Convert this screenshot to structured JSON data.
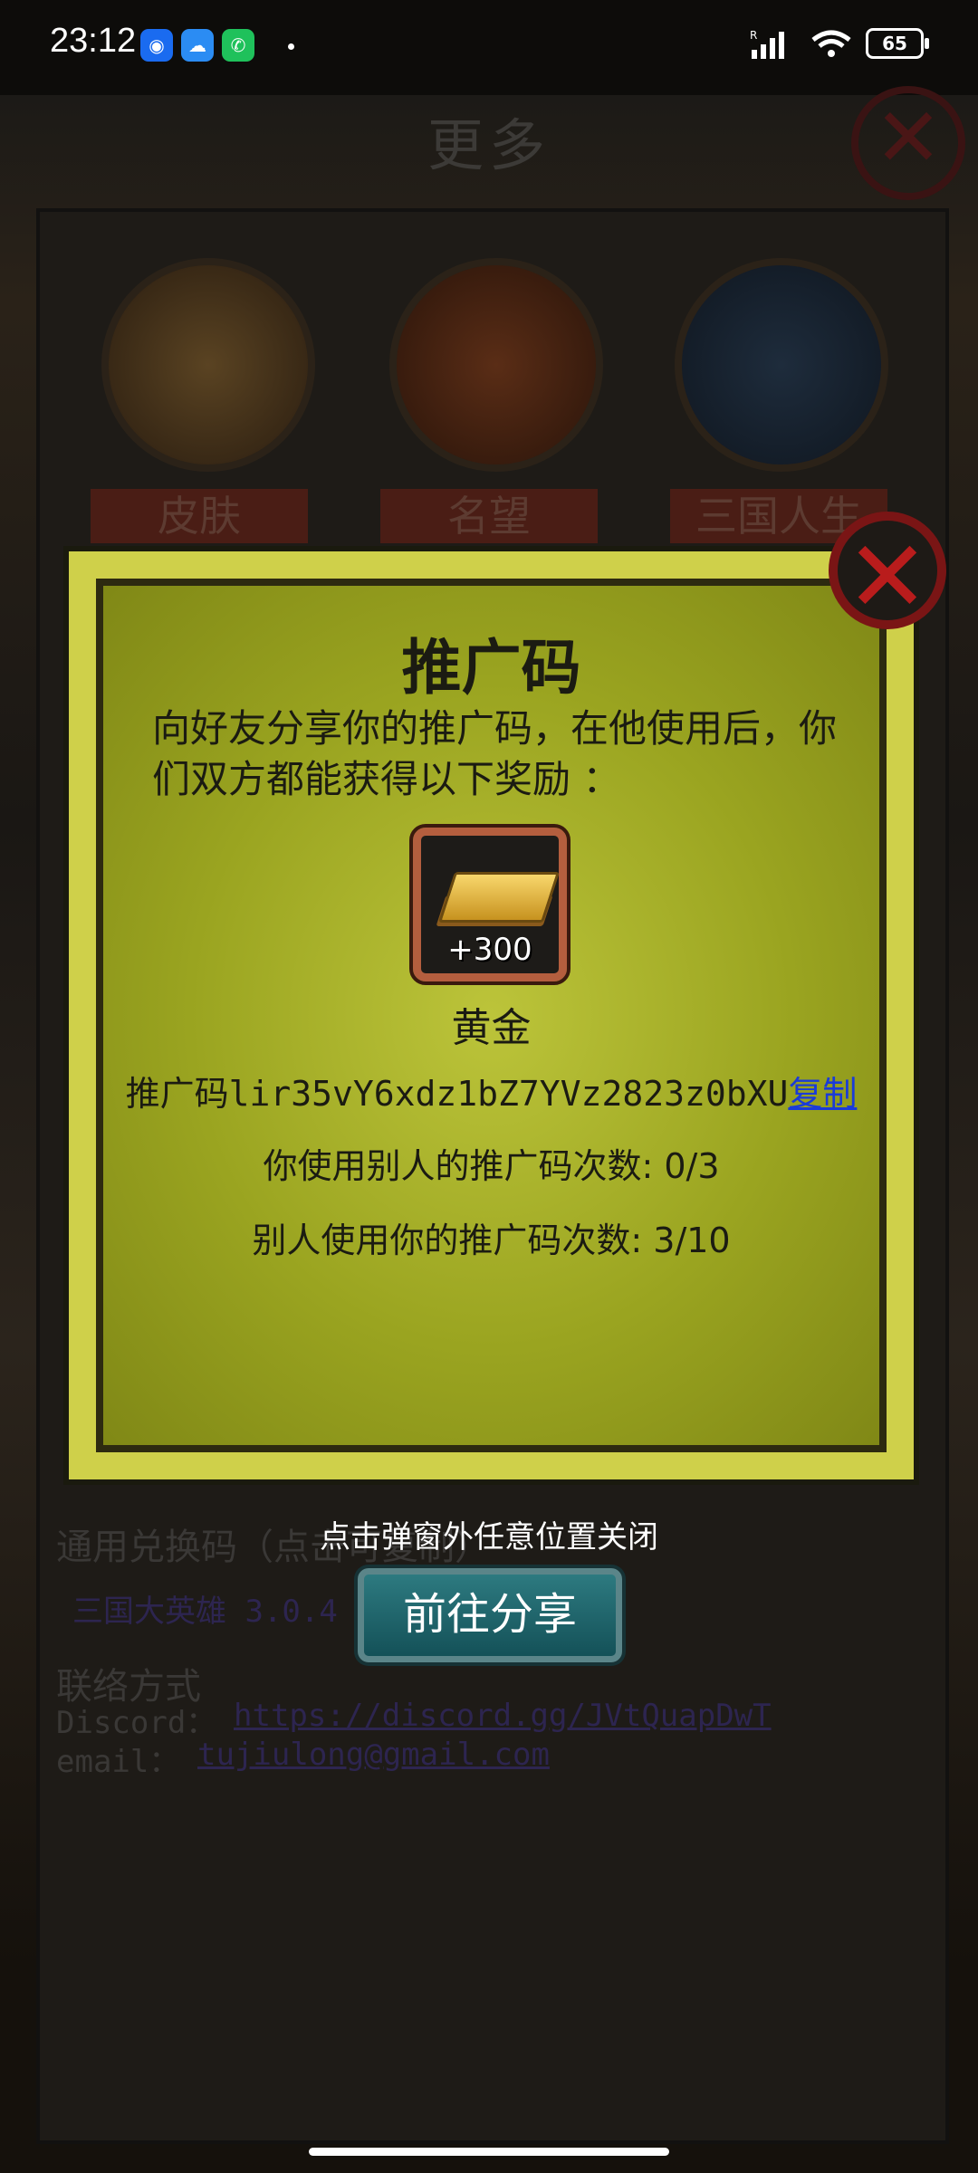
{
  "status_bar": {
    "time": "23:12",
    "battery": "65",
    "signal_label": "R"
  },
  "background": {
    "title": "更多",
    "tabs": [
      "皮肤",
      "名望",
      "三国人生"
    ],
    "redeem_label": "通用兑换码（点击可复制）",
    "redeem_code": "三国大英雄  3.0.4",
    "contact_label": "联络方式",
    "discord_label": "Discord：",
    "discord_link": "https://discord.gg/JVtQuapDwT",
    "email_label": "email：",
    "email_link": "tujiulong@gmail.com"
  },
  "dialog": {
    "title": "推广码",
    "description": "向好友分享你的推广码，在他使用后，你们双方都能获得以下奖励 ：",
    "reward": {
      "amount": "+300",
      "name": "黄金",
      "icon": "gold-bar-icon"
    },
    "code_prefix": "推广码",
    "code_value": "lir35vY6xdz1bZ7YVz2823z0bXU",
    "copy_label": "复制",
    "used_others": "你使用别人的推广码次数: 0/3",
    "others_used": "别人使用你的推广码次数: 3/10"
  },
  "hint": "点击弹窗外任意位置关闭",
  "share_button": "前往分享",
  "colors": {
    "dialog_bg": "#9aa420",
    "copy_link": "#1a3bd8",
    "share_button": "#1e6a70",
    "close_red": "#b91c1c"
  }
}
